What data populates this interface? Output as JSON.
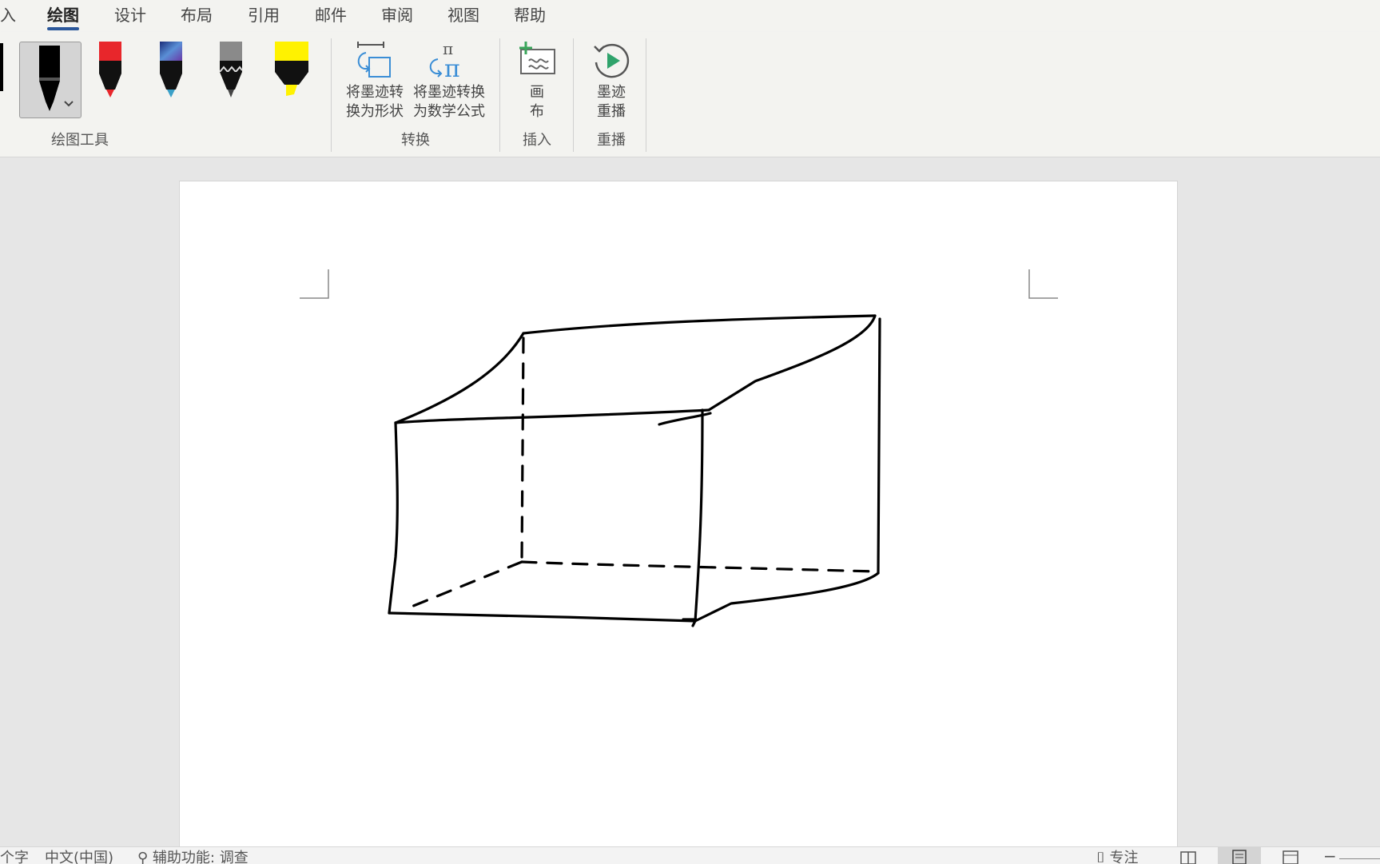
{
  "tabs": [
    {
      "label": "入",
      "active": false
    },
    {
      "label": "绘图",
      "active": true
    },
    {
      "label": "设计",
      "active": false
    },
    {
      "label": "布局",
      "active": false
    },
    {
      "label": "引用",
      "active": false
    },
    {
      "label": "邮件",
      "active": false
    },
    {
      "label": "审阅",
      "active": false
    },
    {
      "label": "视图",
      "active": false
    },
    {
      "label": "帮助",
      "active": false
    }
  ],
  "ribbon": {
    "groups": {
      "drawing_tools": {
        "label": "绘图工具"
      },
      "convert": {
        "label": "转换",
        "ink_to_shape": {
          "line1": "将墨迹转",
          "line2": "换为形状"
        },
        "ink_to_math": {
          "line1": "将墨迹转换",
          "line2": "为数学公式"
        }
      },
      "insert": {
        "label": "插入",
        "canvas": {
          "line1": "画",
          "line2": "布"
        }
      },
      "replay": {
        "label": "重播",
        "ink_replay": {
          "line1": "墨迹",
          "line2": "重播"
        }
      }
    },
    "pens": [
      {
        "name": "black-pen",
        "color": "#000000",
        "selected": true
      },
      {
        "name": "red-pen",
        "color": "#e8262b"
      },
      {
        "name": "galaxy-pen",
        "color": "#3c5fa8"
      },
      {
        "name": "pencil",
        "color": "#8a8a8a"
      },
      {
        "name": "highlighter",
        "color": "#fff200"
      }
    ]
  },
  "colors": {
    "accent": "#2b579a",
    "ink": "#000000"
  },
  "status": {
    "word_count": "个字",
    "language": "中文(中国)",
    "accessibility": "辅助功能: 调查",
    "focus": "专注"
  }
}
